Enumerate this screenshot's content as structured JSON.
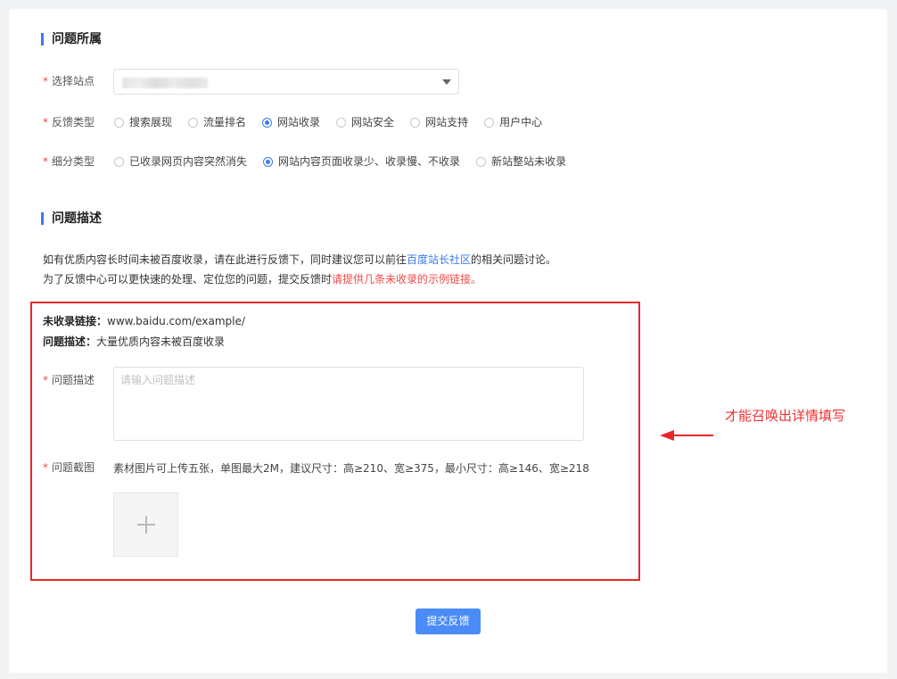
{
  "section1": {
    "title": "问题所属"
  },
  "site": {
    "label": "选择站点",
    "required_mark": "*"
  },
  "feedback_type": {
    "label": "反馈类型",
    "required_mark": "*",
    "options": [
      {
        "label": "搜索展现",
        "checked": false
      },
      {
        "label": "流量排名",
        "checked": false
      },
      {
        "label": "网站收录",
        "checked": true
      },
      {
        "label": "网站安全",
        "checked": false
      },
      {
        "label": "网站支持",
        "checked": false
      },
      {
        "label": "用户中心",
        "checked": false
      }
    ]
  },
  "sub_type": {
    "label": "细分类型",
    "required_mark": "*",
    "options": [
      {
        "label": "已收录网页内容突然消失",
        "checked": false
      },
      {
        "label": "网站内容页面收录少、收录慢、不收录",
        "checked": true
      },
      {
        "label": "新站整站未收录",
        "checked": false
      }
    ]
  },
  "section2": {
    "title": "问题描述"
  },
  "intro": {
    "line1_before": "如有优质内容长时间未被百度收录，请在此进行反馈下，同时建议您可以前往",
    "line1_link": "百度站长社区",
    "line1_after": "的相关问题讨论。",
    "line2_before": "为了反馈中心可以更快速的处理、定位您的问题，提交反馈时",
    "line2_warn": "请提供几条未收录的示例链接。"
  },
  "example": {
    "link_label": "未收录链接：",
    "link_value": "www.baidu.com/example/",
    "desc_label": "问题描述：",
    "desc_value": "大量优质内容未被百度收录"
  },
  "description": {
    "label": "问题描述",
    "required_mark": "*",
    "placeholder": "请输入问题描述"
  },
  "screenshot": {
    "label": "问题截图",
    "required_mark": "*",
    "hint": "素材图片可上传五张，单图最大2M，建议尺寸：高≥210、宽≥375，最小尺寸：高≥146、宽≥218"
  },
  "submit": {
    "label": "提交反馈"
  },
  "annotation": {
    "text": "才能召唤出详情填写",
    "color": "#f03030"
  },
  "colors": {
    "accent": "#3a7bf0",
    "required": "#f04a4a",
    "highlight_box": "#e8262a"
  }
}
